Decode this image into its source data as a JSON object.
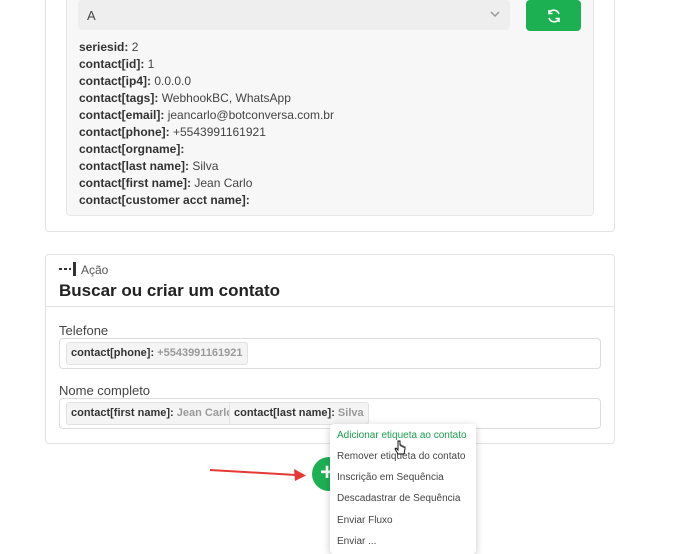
{
  "top_card": {
    "select_value": "A",
    "fields": [
      {
        "key": "seriesid:",
        "value": "2"
      },
      {
        "key": "contact[id]:",
        "value": "1"
      },
      {
        "key": "contact[ip4]:",
        "value": "0.0.0.0"
      },
      {
        "key": "contact[tags]:",
        "value": "WebhookBC, WhatsApp"
      },
      {
        "key": "contact[email]:",
        "value": "jeancarlo@botconversa.com.br"
      },
      {
        "key": "contact[phone]:",
        "value": "+5543991161921"
      },
      {
        "key": "contact[orgname]:",
        "value": ""
      },
      {
        "key": "contact[last name]:",
        "value": "Silva"
      },
      {
        "key": "contact[first name]:",
        "value": "Jean Carlo"
      },
      {
        "key": "contact[customer acct name]:",
        "value": ""
      }
    ]
  },
  "action": {
    "label": "Ação",
    "title": "Buscar ou criar um contato",
    "phone_label": "Telefone",
    "phone_chip": {
      "key": "contact[phone]:",
      "value": "+5543991161921"
    },
    "name_label": "Nome completo",
    "first_name_chip": {
      "key": "contact[first name]:",
      "value": "Jean Carlo"
    },
    "last_name_chip": {
      "key": "contact[last name]:",
      "value": "Silva"
    }
  },
  "add_button": {
    "label": "+"
  },
  "menu": {
    "items": [
      {
        "label": "Adicionar etiqueta ao contato",
        "active": true
      },
      {
        "label": "Remover etiqueta do contato"
      },
      {
        "label": "Inscrição em Sequência"
      },
      {
        "label": "Descadastrar de Sequência"
      },
      {
        "label": "Enviar Fluxo"
      },
      {
        "label": "Enviar ..."
      }
    ]
  },
  "colors": {
    "accent": "#1db053",
    "accent_text": "#1a9e4b",
    "arrow": "#e53935"
  }
}
